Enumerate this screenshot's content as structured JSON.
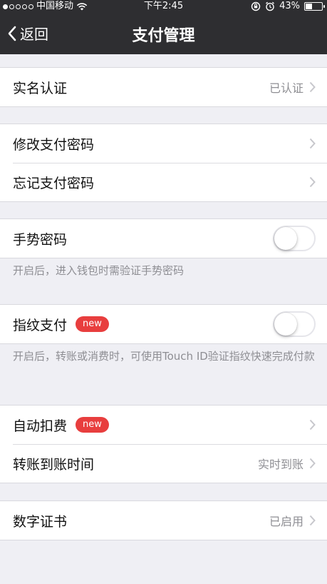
{
  "status_bar": {
    "carrier": "中国移动",
    "time": "下午2:45",
    "battery_text": "43%",
    "battery_level": 0.43
  },
  "nav": {
    "back_label": "返回",
    "title": "支付管理"
  },
  "rows": {
    "real_name": {
      "label": "实名认证",
      "value": "已认证"
    },
    "change_password": {
      "label": "修改支付密码"
    },
    "forgot_password": {
      "label": "忘记支付密码"
    },
    "gesture": {
      "label": "手势密码",
      "enabled": false,
      "hint": "开启后，进入钱包时需验证手势密码"
    },
    "fingerprint": {
      "label": "指纹支付",
      "badge": "new",
      "enabled": false,
      "hint": "开启后，转账或消费时，可使用Touch ID验证指纹快速完成付款"
    },
    "auto_deduct": {
      "label": "自动扣费",
      "badge": "new"
    },
    "transfer_time": {
      "label": "转账到账时间",
      "value": "实时到账"
    },
    "certificate": {
      "label": "数字证书",
      "value": "已启用"
    }
  },
  "icons": [
    "signal-icon",
    "wifi-icon",
    "rotation-lock-icon",
    "alarm-icon",
    "battery-icon",
    "back-chevron-icon",
    "chevron-right-icon"
  ]
}
